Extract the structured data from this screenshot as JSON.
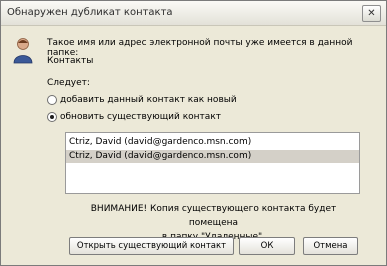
{
  "dialog": {
    "title": "Обнаружен дубликат контакта",
    "close_label": "✕",
    "message_line1": "Такое имя или адрес электронной почты уже имеется в данной папке:",
    "message_line2": "Контакты",
    "follow_label": "Следует:",
    "options": [
      {
        "label": "добавить данный контакт как новый",
        "selected": false
      },
      {
        "label": "обновить существующий контакт",
        "selected": true
      }
    ],
    "list_items": [
      {
        "text": "Ctriz, David (david@gardenco.msn.com)",
        "selected": false
      },
      {
        "text": "Ctriz, David (david@gardenco.msn.com)",
        "selected": true
      }
    ],
    "warning_line1": "ВНИМАНИЕ! Копия существующего контакта будет помещена",
    "warning_line2": "в папку \"Удаленные\".",
    "buttons": {
      "open": "Открыть существующий контакт",
      "ok": "ОК",
      "cancel": "Отмена"
    }
  }
}
